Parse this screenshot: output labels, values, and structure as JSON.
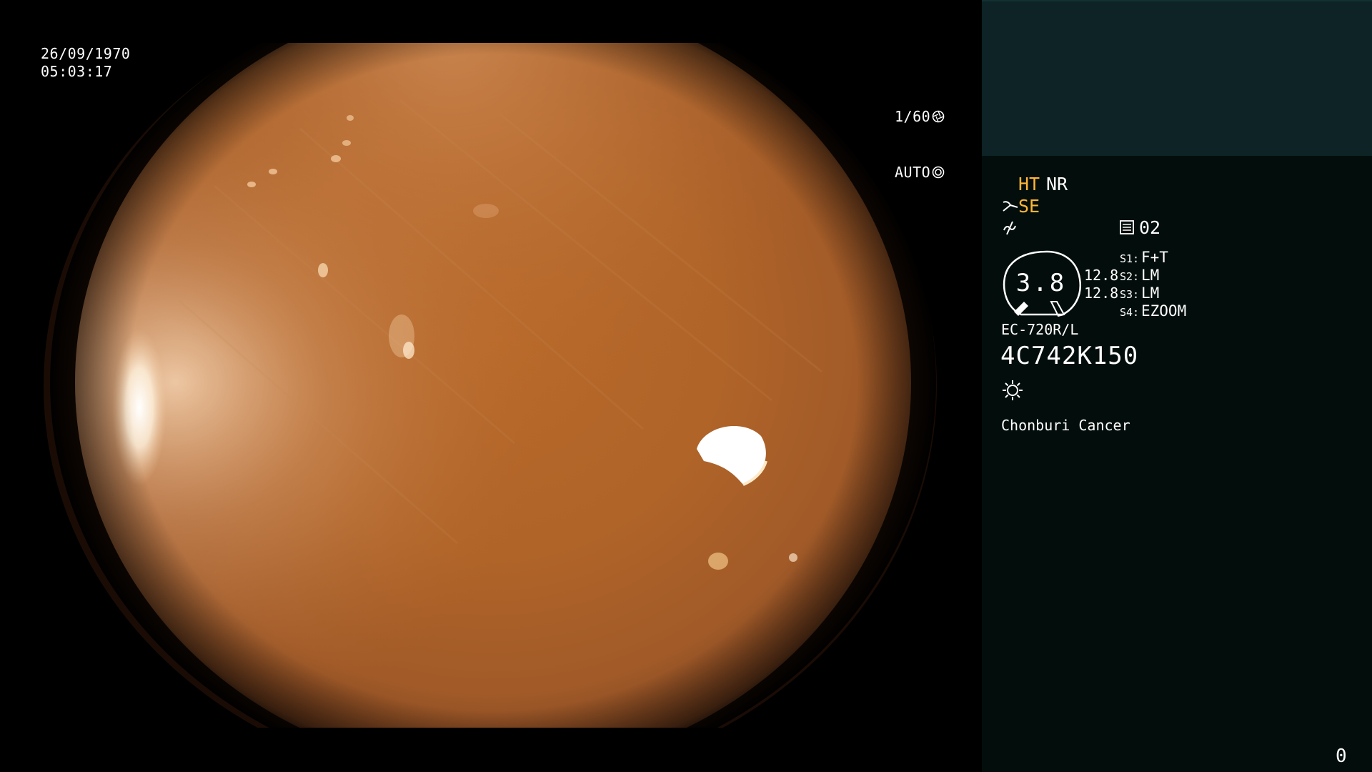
{
  "image": {
    "description_icons": [
      "shutter-icon",
      "iris-icon",
      "scissors-icon",
      "enhance-icon",
      "memo-icon",
      "light-icon"
    ],
    "colors": {
      "background": "#000000",
      "panel": "#030e0c",
      "panel_top": "#0d2325",
      "highlight": "#ffb637",
      "text": "#ffffff"
    }
  },
  "overlay": {
    "date": "26/09/1970",
    "time": "05:03:17",
    "shutter": "1/60",
    "iris_mode": "AUTO"
  },
  "panel": {
    "mode_ht": "HT",
    "mode_nr": "NR",
    "mode_se": "SE",
    "memo_value": "02",
    "zoom_value": "3.8",
    "value_a": "12.8",
    "value_b": "12.8",
    "switches": [
      {
        "key": "S1:",
        "value": "F+T"
      },
      {
        "key": "S2:",
        "value": "LM"
      },
      {
        "key": "S3:",
        "value": "LM"
      },
      {
        "key": "S4:",
        "value": "EZOOM"
      }
    ],
    "scope_model": "EC-720R/L",
    "scope_serial": "4C742K150",
    "hospital": "Chonburi Cancer",
    "counter": "0"
  }
}
